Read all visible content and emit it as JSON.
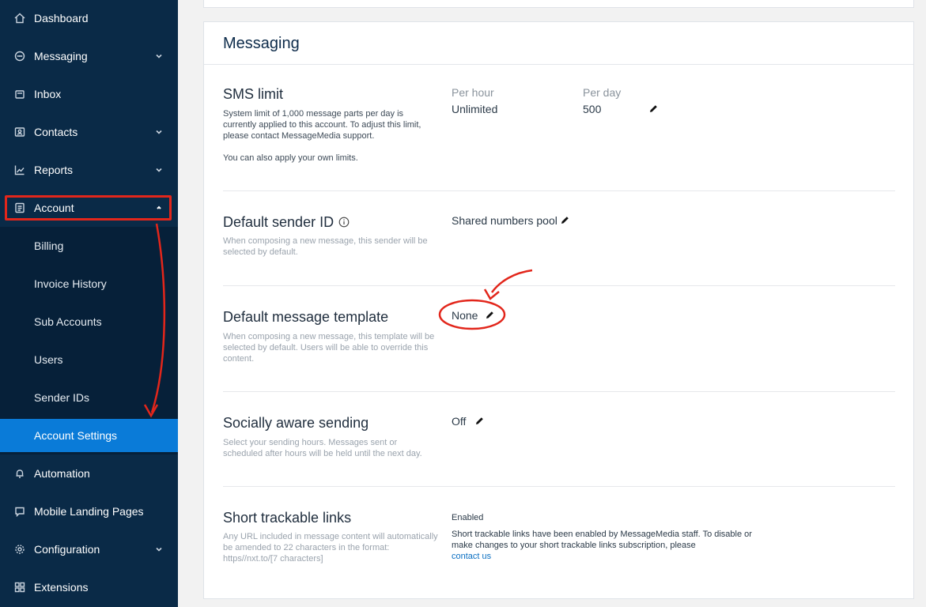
{
  "sidebar": {
    "items": [
      {
        "label": "Dashboard",
        "icon": "home-icon"
      },
      {
        "label": "Messaging",
        "icon": "chat-icon"
      },
      {
        "label": "Inbox",
        "icon": "inbox-icon"
      },
      {
        "label": "Contacts",
        "icon": "contacts-icon"
      },
      {
        "label": "Reports",
        "icon": "chart-icon"
      },
      {
        "label": "Account",
        "icon": "document-icon"
      },
      {
        "label": "Automation",
        "icon": "bell-icon"
      },
      {
        "label": "Mobile Landing Pages",
        "icon": "page-icon"
      },
      {
        "label": "Configuration",
        "icon": "gear-icon"
      },
      {
        "label": "Extensions",
        "icon": "grid-icon"
      }
    ],
    "account_sub": [
      "Billing",
      "Invoice History",
      "Sub Accounts",
      "Users",
      "Sender IDs",
      "Account Settings"
    ]
  },
  "colors": {
    "sidebar": "#0a2a47",
    "active": "#0a7bd8",
    "annotation": "#e2261b"
  },
  "messaging": {
    "title": "Messaging",
    "sms_limit": {
      "title": "SMS limit",
      "desc": "System limit of 1,000 message parts per day is currently applied to this account. To adjust this limit, please contact MessageMedia support.",
      "desc2": "You can also apply your own limits.",
      "per_hour_label": "Per hour",
      "per_hour_value": "Unlimited",
      "per_day_label": "Per day",
      "per_day_value": "500"
    },
    "sender_id": {
      "title": "Default sender ID",
      "desc": "When composing a new message, this sender will be selected by default.",
      "value": "Shared numbers pool"
    },
    "template": {
      "title": "Default message template",
      "desc": "When composing a new message, this template will be selected by default. Users will be able to override this content.",
      "value": "None"
    },
    "social": {
      "title": "Socially aware sending",
      "desc": "Select your sending hours. Messages sent or scheduled after hours will be held until the next day.",
      "value": "Off"
    },
    "links": {
      "title": "Short trackable links",
      "desc": "Any URL included in message content will automatically be amended to 22 characters in the format: https//nxt.to/[7 characters]",
      "status": "Enabled",
      "info": "Short trackable links have been enabled by MessageMedia staff. To disable or make changes to your short trackable links subscription, please",
      "contact": "contact us"
    }
  }
}
